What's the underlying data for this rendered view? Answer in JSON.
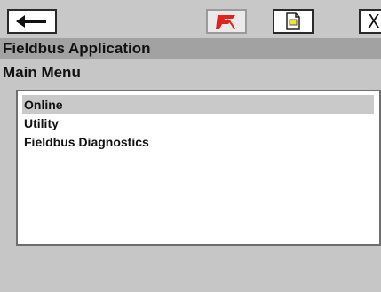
{
  "toolbar": {
    "back_icon": "left-arrow-icon",
    "fieldbus_icon": "fieldbus-logo-icon",
    "document_icon": "document-icon",
    "close_label": "X",
    "colors": {
      "fieldbus_red": "#e0241b",
      "document_yellow": "#f0e23c"
    }
  },
  "app": {
    "title": "Fieldbus Application"
  },
  "menu": {
    "title": "Main Menu",
    "selected_index": 0,
    "items": [
      {
        "label": "Online"
      },
      {
        "label": "Utility"
      },
      {
        "label": "Fieldbus Diagnostics"
      }
    ]
  }
}
